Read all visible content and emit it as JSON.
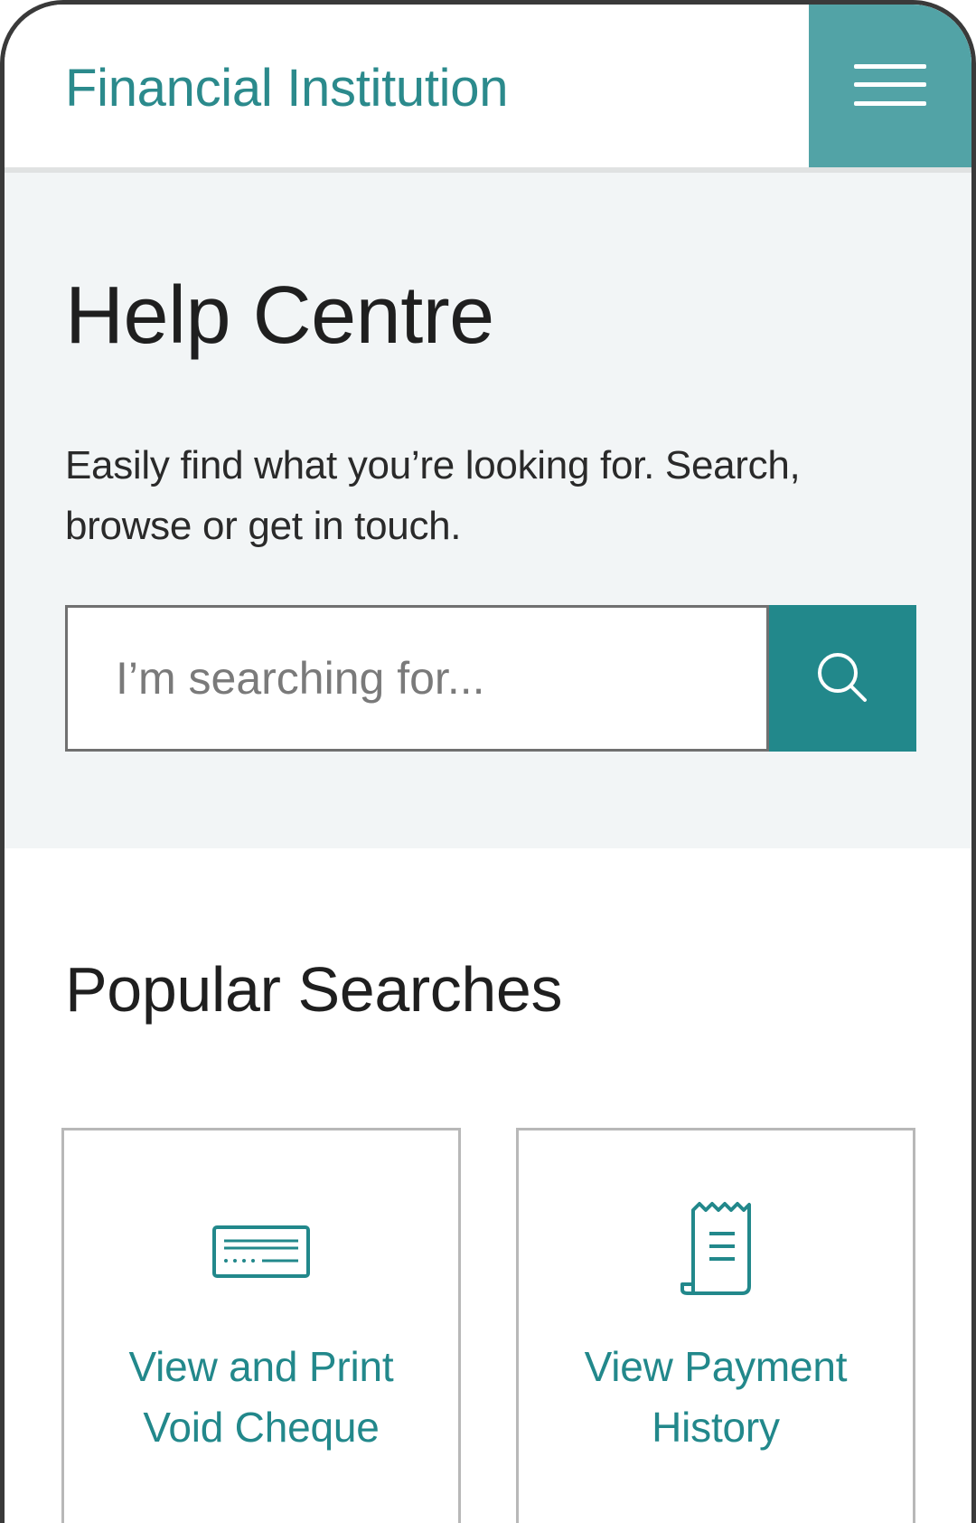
{
  "header": {
    "brand": "Financial Institution",
    "menu_icon": "hamburger-menu-icon"
  },
  "hero": {
    "title": "Help Centre",
    "description": "Easily find what you’re looking for. Search, browse or get in touch.",
    "search": {
      "placeholder": "I’m searching for...",
      "value": "",
      "button_icon": "search-icon"
    }
  },
  "popular": {
    "title": "Popular Searches",
    "cards": [
      {
        "label_line1": "View and Print",
        "label_line2": "Void Cheque",
        "icon": "cheque-icon"
      },
      {
        "label_line1": "View Payment",
        "label_line2": "History",
        "icon": "receipt-icon"
      }
    ]
  },
  "colors": {
    "brand_teal": "#2b8a8c",
    "menu_teal": "#52a3a6",
    "button_teal": "#22888b",
    "hero_bg": "#f2f5f6",
    "card_border": "#b8b8b8"
  }
}
